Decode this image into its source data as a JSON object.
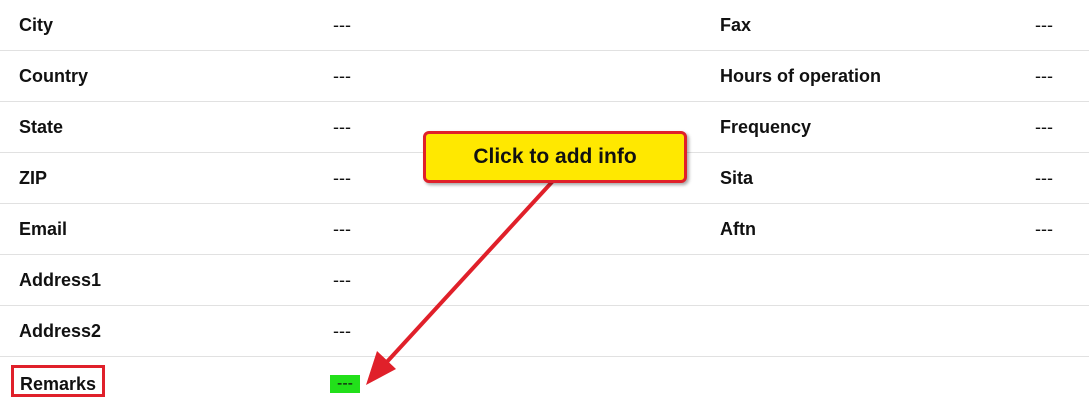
{
  "rows": [
    {
      "label1": "City",
      "value1": "---",
      "label2": "Fax",
      "value2": "---"
    },
    {
      "label1": "Country",
      "value1": "---",
      "label2": "Hours of operation",
      "value2": "---"
    },
    {
      "label1": "State",
      "value1": "---",
      "label2": "Frequency",
      "value2": "---"
    },
    {
      "label1": "ZIP",
      "value1": "---",
      "label2": "Sita",
      "value2": "---"
    },
    {
      "label1": "Email",
      "value1": "---",
      "label2": "Aftn",
      "value2": "---"
    },
    {
      "label1": "Address1",
      "value1": "---"
    },
    {
      "label1": "Address2",
      "value1": "---"
    },
    {
      "label1": "Remarks",
      "value1": "---"
    }
  ],
  "callout": {
    "text": "Click to add info",
    "background": "#ffe800",
    "border": "#e0202a"
  },
  "colors": {
    "highlight_green": "#22e01a",
    "annotation_red": "#e0202a",
    "row_divider": "#e1e1e1"
  }
}
